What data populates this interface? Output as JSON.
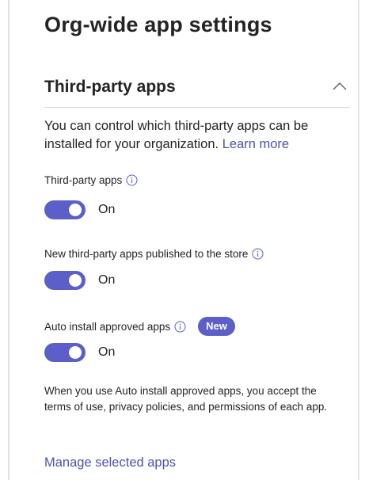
{
  "page_title": "Org-wide app settings",
  "section": {
    "title": "Third-party apps",
    "collapse_icon": "chevron-up-icon",
    "description": "You can control which third-party apps can be installed for your organization.",
    "learn_more_label": "Learn more"
  },
  "settings": [
    {
      "label": "Third-party apps",
      "info_icon": "info-icon",
      "state_label": "On",
      "enabled": true
    },
    {
      "label": "New third-party apps published to the store",
      "info_icon": "info-icon",
      "state_label": "On",
      "enabled": true
    },
    {
      "label": "Auto install approved apps",
      "info_icon": "info-icon",
      "badge": "New",
      "state_label": "On",
      "enabled": true
    }
  ],
  "footnote": "When you use Auto install approved apps, you accept the terms of use, privacy policies, and permissions of each app.",
  "manage_link_label": "Manage selected apps",
  "colors": {
    "accent": "#5b5fc7",
    "link": "#4f52b2",
    "text": "#242424"
  }
}
